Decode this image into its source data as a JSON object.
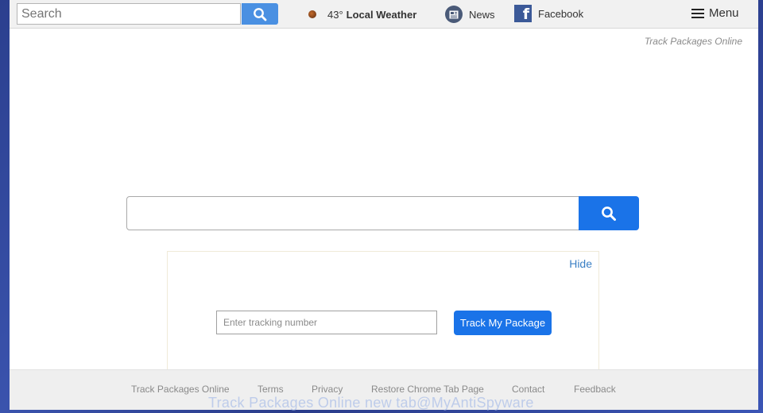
{
  "topbar": {
    "search_placeholder": "Search",
    "weather_temp": "43°",
    "weather_label": "Local Weather",
    "news_label": "News",
    "facebook_label": "Facebook",
    "menu_label": "Menu"
  },
  "brand_tag": "Track Packages Online",
  "tracking": {
    "hide_label": "Hide",
    "input_placeholder": "Enter tracking number",
    "button_label": "Track My Package"
  },
  "footer": {
    "links": [
      "Track Packages Online",
      "Terms",
      "Privacy",
      "Restore Chrome Tab Page",
      "Contact",
      "Feedback"
    ]
  },
  "watermark": "Track Packages Online new tab@MyAntiSpyware",
  "colors": {
    "accent_blue": "#1a73e8",
    "top_search_blue": "#4a90e2",
    "facebook_blue": "#3b5998",
    "link_blue": "#3a7fc4"
  },
  "icons": [
    "search-icon",
    "weather-icon",
    "news-icon",
    "facebook-icon",
    "menu-icon"
  ]
}
